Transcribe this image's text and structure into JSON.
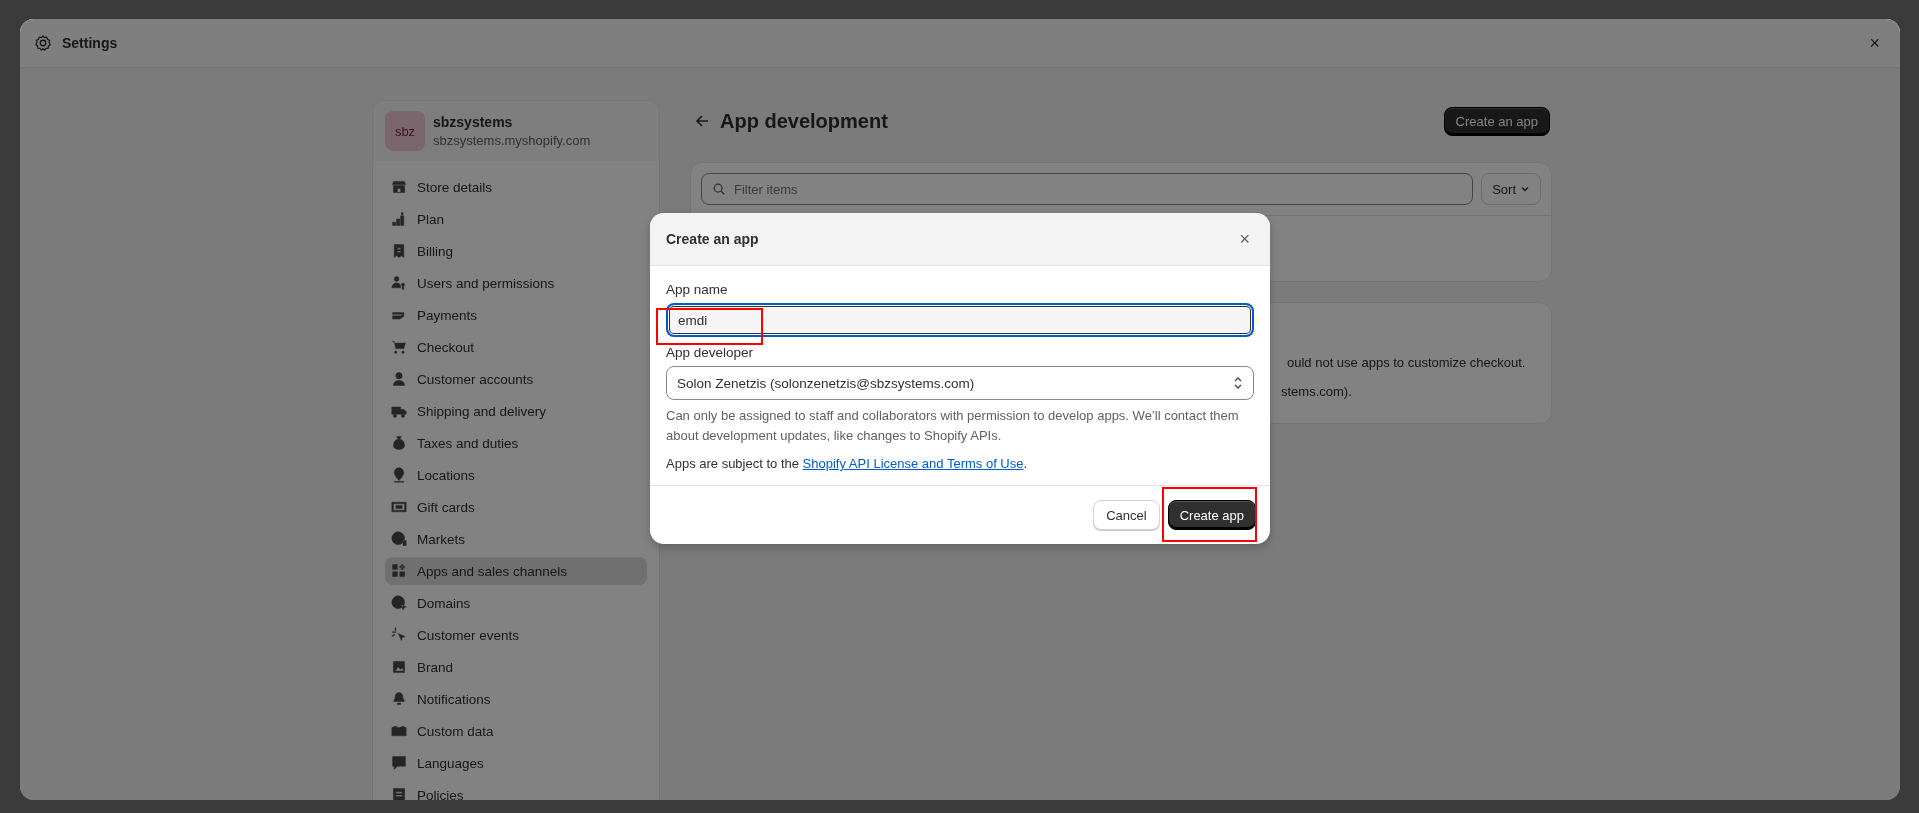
{
  "window": {
    "title": "Settings",
    "close": "×"
  },
  "store": {
    "avatar": "sbz",
    "name": "sbzsystems",
    "domain": "sbzsystems.myshopify.com"
  },
  "sidebar": {
    "items": [
      {
        "label": "Store details",
        "selected": false
      },
      {
        "label": "Plan",
        "selected": false
      },
      {
        "label": "Billing",
        "selected": false
      },
      {
        "label": "Users and permissions",
        "selected": false
      },
      {
        "label": "Payments",
        "selected": false
      },
      {
        "label": "Checkout",
        "selected": false
      },
      {
        "label": "Customer accounts",
        "selected": false
      },
      {
        "label": "Shipping and delivery",
        "selected": false
      },
      {
        "label": "Taxes and duties",
        "selected": false
      },
      {
        "label": "Locations",
        "selected": false
      },
      {
        "label": "Gift cards",
        "selected": false
      },
      {
        "label": "Markets",
        "selected": false
      },
      {
        "label": "Apps and sales channels",
        "selected": true
      },
      {
        "label": "Domains",
        "selected": false
      },
      {
        "label": "Customer events",
        "selected": false
      },
      {
        "label": "Brand",
        "selected": false
      },
      {
        "label": "Notifications",
        "selected": false
      },
      {
        "label": "Custom data",
        "selected": false
      },
      {
        "label": "Languages",
        "selected": false
      },
      {
        "label": "Policies",
        "selected": false
      }
    ]
  },
  "page": {
    "title": "App development",
    "create_button": "Create an app",
    "filter": {
      "placeholder": "Filter items"
    },
    "sort": "Sort",
    "notice_lines": [
      "ould not use apps to customize checkout.",
      "stems.com)."
    ]
  },
  "dialog": {
    "title": "Create an app",
    "close": "×",
    "app_name": {
      "label": "App name",
      "value": "emdi",
      "highlighted": true
    },
    "app_developer": {
      "label": "App developer",
      "value": "Solon Zenetzis (solonzenetzis@sbzsystems.com)"
    },
    "help": "Can only be assigned to staff and collaborators with permission to develop apps. We’ll contact them about development updates, like changes to Shopify APIs.",
    "terms_prefix": "Apps are subject to the",
    "terms_link": "Shopify API License and Terms of Use",
    "terms_suffix": ".",
    "buttons": [
      {
        "label": "Cancel",
        "kind": "secondary",
        "highlighted": false
      },
      {
        "label": "Create app",
        "kind": "primary",
        "highlighted": true
      }
    ]
  }
}
